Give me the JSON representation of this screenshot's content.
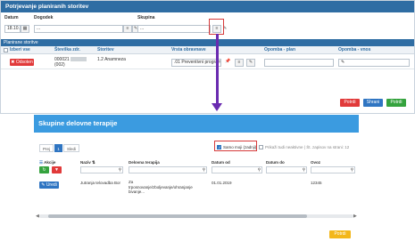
{
  "top_window": {
    "title": "Potrjevanje planiranih storitev",
    "labels": {
      "datum": "Datum",
      "dogodek": "Dogodek",
      "skupina": "Skupina"
    },
    "values": {
      "datum": "18.10.",
      "dogodek": "...",
      "skupina": "..."
    },
    "section_title": "Planirane storitve",
    "columns": {
      "izberi": "Izberi vse",
      "stevilka": "Številka zdr.",
      "storitev": "Storitev",
      "vrsta": "Vrsta obravnave",
      "opomba_plan": "Opomba - plan",
      "opomba_vnos": "Opomba - vnos"
    },
    "row": {
      "status": "Odsoten",
      "stevilka": "000021",
      "stevilka2": "(002)",
      "storitev": "1.2 Anamneza",
      "vrsta": ".01 Preventivni program"
    },
    "buttons": {
      "potrdi_red": "Potrdi",
      "shrani": "Shrani",
      "potrdi": "Potrdi"
    }
  },
  "bottom_window": {
    "title": "Skupine delovne terapije",
    "pager": {
      "prev": "Prej",
      "page": "1",
      "next": "Sledi"
    },
    "options": {
      "samo_moji": "Samo moji (zadnji)",
      "prikazi_vse": "Prikaži tudi neaktivne | Št. zapisov na strani: 12"
    },
    "columns": {
      "akcije": "Akcije",
      "naziv": "Naziv",
      "delovna_terapija": "Delovna terapija",
      "datum_od": "Datum od",
      "datum_do": "Datum do",
      "ovoz": "Ovoz"
    },
    "row": {
      "naziv": "Jutranja telovadba Bor",
      "delovna_terapija_lines": [
        "Za",
        "trposnovanje/zboljevanje/ohranjanje",
        "bivanje..."
      ],
      "datum_od": "01.01.2019",
      "ovoz": "12345",
      "uredi": "Uredi"
    },
    "buttons": {
      "potrdi": "Potrdi"
    }
  },
  "colors": {
    "header_dark": "#2f6da3",
    "header_light": "#3b9be0",
    "arrow": "#6a2bb0",
    "highlight": "#d63a3a"
  },
  "icons": {
    "calendar": "calendar-icon",
    "list": "list-icon",
    "edit": "pencil-icon",
    "search": "search-icon",
    "refresh": "refresh-icon",
    "filter": "filter-icon"
  }
}
